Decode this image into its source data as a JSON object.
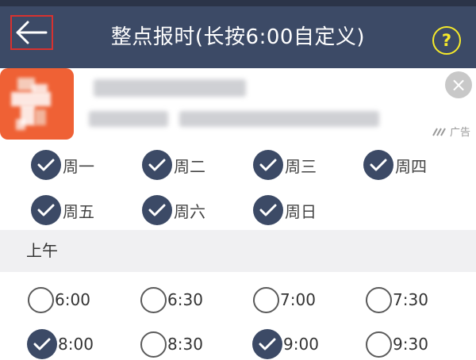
{
  "header": {
    "title": "整点报时(长按6:00自定义)",
    "help_label": "?"
  },
  "ad": {
    "label": "广告",
    "close_label": "×"
  },
  "days": [
    {
      "label": "周一",
      "checked": true
    },
    {
      "label": "周二",
      "checked": true
    },
    {
      "label": "周三",
      "checked": true
    },
    {
      "label": "周四",
      "checked": true
    },
    {
      "label": "周五",
      "checked": true
    },
    {
      "label": "周六",
      "checked": true
    },
    {
      "label": "周日",
      "checked": true
    }
  ],
  "section": {
    "title": "上午"
  },
  "time_slots": [
    {
      "label": "6:00",
      "checked": false
    },
    {
      "label": "6:30",
      "checked": false
    },
    {
      "label": "7:00",
      "checked": false
    },
    {
      "label": "7:30",
      "checked": false
    },
    {
      "label": "8:00",
      "checked": true
    },
    {
      "label": "8:30",
      "checked": false
    },
    {
      "label": "9:00",
      "checked": true
    },
    {
      "label": "9:30",
      "checked": false
    }
  ],
  "colors": {
    "header_bg": "#3c4a66",
    "accent_check": "#3c4a66",
    "help_yellow": "#f6ea2a",
    "back_outline": "#d8322f",
    "ad_icon_orange": "#ef6135"
  }
}
